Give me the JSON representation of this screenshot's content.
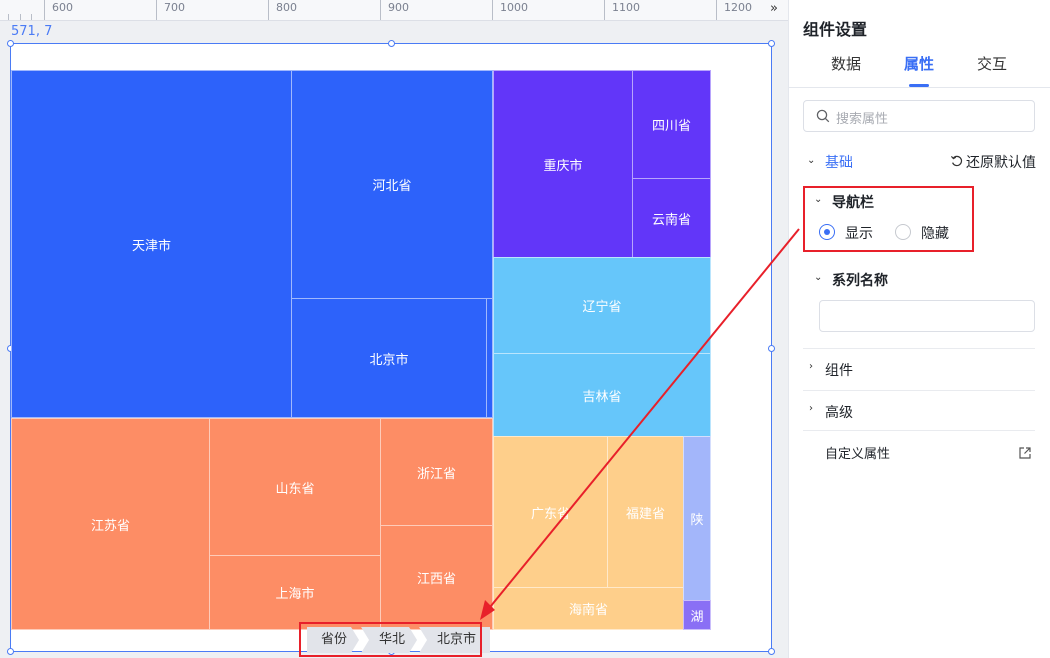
{
  "ruler": {
    "labels": [
      "600",
      "700",
      "800",
      "900",
      "1000",
      "1100",
      "1200"
    ]
  },
  "canvas": {
    "coords": "571, 7"
  },
  "treemap": {
    "colors": {
      "blue": "#2d62fa",
      "purple": "#6236f9",
      "sky": "#66c6fa",
      "orange": "#fd8d65",
      "yellow": "#fecf8b",
      "lavender": "#a3b6fa",
      "violet": "#8a6ff5"
    },
    "cells": {
      "tianjin": "天津市",
      "hebei": "河北省",
      "beijing": "北京市",
      "chongqing": "重庆市",
      "sichuan": "四川省",
      "yunnan": "云南省",
      "liaoning": "辽宁省",
      "jilin": "吉林省",
      "jiangsu": "江苏省",
      "shandong": "山东省",
      "zhejiang": "浙江省",
      "shanghai": "上海市",
      "jiangxi": "江西省",
      "guangdong": "广东省",
      "fujian": "福建省",
      "hainan": "海南省",
      "shaanxi": "陕",
      "hu": "湖"
    }
  },
  "breadcrumb": [
    "省份",
    "华北",
    "北京市"
  ],
  "annotation": {
    "color": "#e8202a"
  },
  "panel": {
    "title": "组件设置",
    "tabs": [
      "数据",
      "属性",
      "交互"
    ],
    "active_tab": "属性",
    "search_placeholder": "搜索属性",
    "basic": "基础",
    "reset": "还原默认值",
    "navbar": "导航栏",
    "show": "显示",
    "hide": "隐藏",
    "navbar_selected": "显示",
    "series_name": "系列名称",
    "series_name_value": "",
    "component": "组件",
    "advanced": "高级",
    "custom": "自定义属性"
  }
}
